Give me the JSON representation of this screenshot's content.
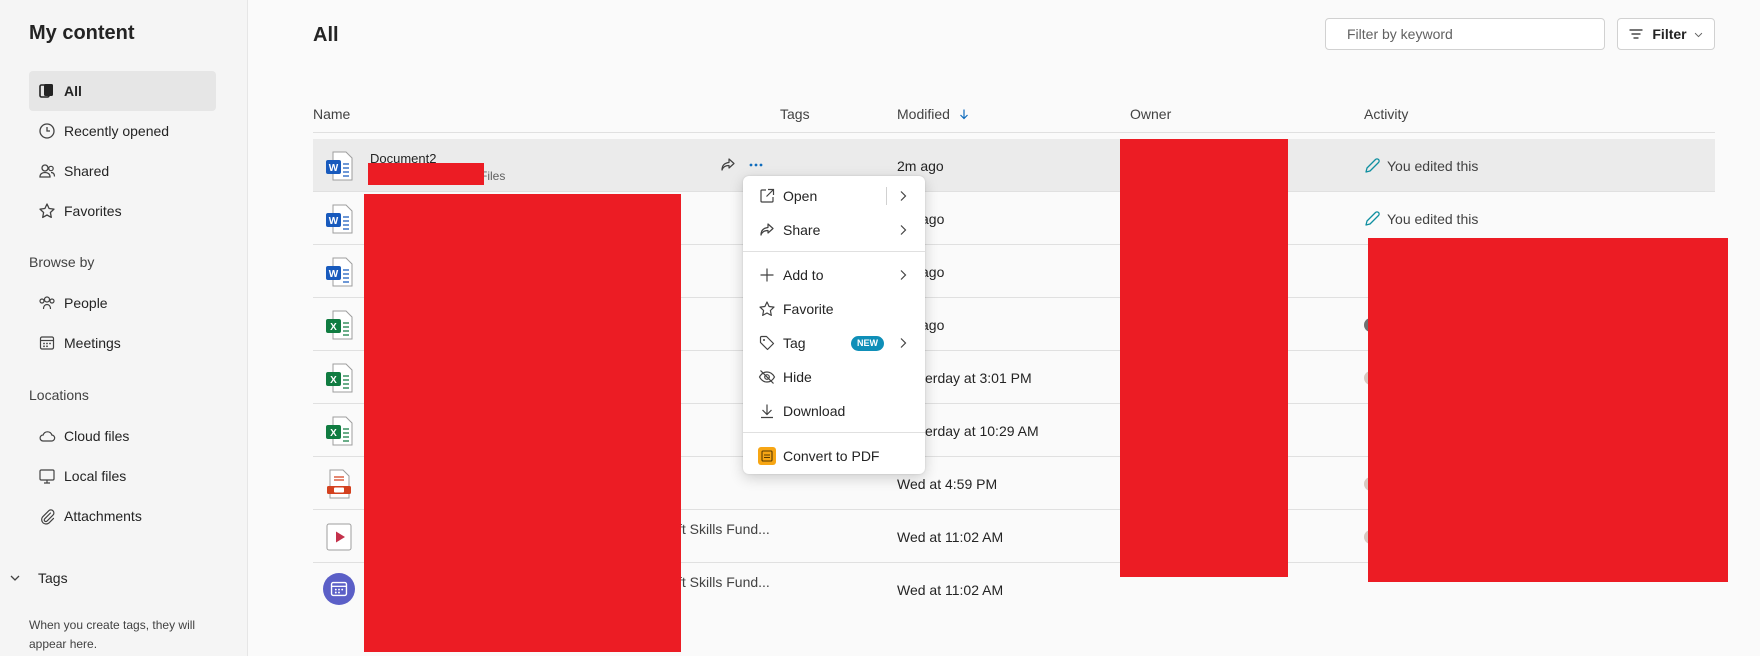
{
  "sidebar": {
    "title": "My content",
    "items": [
      {
        "label": "All"
      },
      {
        "label": "Recently opened"
      },
      {
        "label": "Shared"
      },
      {
        "label": "Favorites"
      }
    ],
    "browse_by": {
      "heading": "Browse by",
      "items": [
        {
          "label": "People"
        },
        {
          "label": "Meetings"
        }
      ]
    },
    "locations": {
      "heading": "Locations",
      "items": [
        {
          "label": "Cloud files"
        },
        {
          "label": "Local files"
        },
        {
          "label": "Attachments"
        }
      ]
    },
    "tags": {
      "heading": "Tags",
      "note": "When you create tags, they will appear here."
    }
  },
  "main": {
    "title": "All",
    "filter_placeholder": "Filter by keyword",
    "filter_button": "Filter",
    "columns": {
      "name": "Name",
      "tags": "Tags",
      "modified": "Modified",
      "owner": "Owner",
      "activity": "Activity"
    },
    "rows": [
      {
        "type": "word",
        "name": "Document2",
        "location": "Files",
        "modified": "2m ago",
        "activity": "You edited this"
      },
      {
        "type": "word",
        "modified": "ago",
        "activity": "You edited this"
      },
      {
        "type": "word",
        "modified": "ago"
      },
      {
        "type": "excel",
        "modified": "ago"
      },
      {
        "type": "excel",
        "modified": "erday at 3:01 PM"
      },
      {
        "type": "excel",
        "modified": "erday at 10:29 AM"
      },
      {
        "type": "pdf",
        "modified": "Wed at 4:59 PM"
      },
      {
        "type": "video",
        "name_tail": "ft Skills Fund...",
        "modified": "Wed at 11:02 AM"
      },
      {
        "type": "meeting",
        "name_tail": "ft Skills Fund...",
        "modified": "Wed at 11:02 AM"
      }
    ]
  },
  "context_menu": {
    "items": [
      {
        "label": "Open"
      },
      {
        "label": "Share"
      },
      {
        "label": "Add to"
      },
      {
        "label": "Favorite"
      },
      {
        "label": "Tag",
        "badge": "NEW"
      },
      {
        "label": "Hide"
      },
      {
        "label": "Download"
      },
      {
        "label": "Convert to PDF"
      }
    ]
  },
  "colors": {
    "word": "#185abd",
    "excel": "#107c41",
    "accent": "#0f6cbd",
    "redaction": "#ec1c24",
    "meeting": "#5b5fc7"
  }
}
